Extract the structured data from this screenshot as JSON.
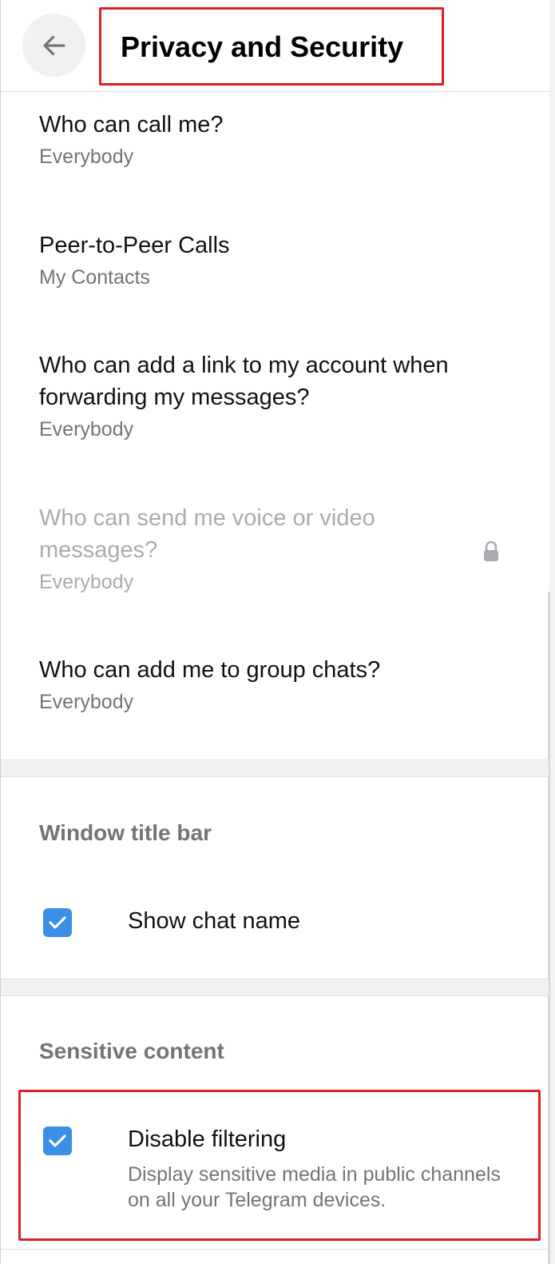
{
  "header": {
    "back_label": "Back",
    "title": "Privacy and Security"
  },
  "privacy_items": [
    {
      "title": "Who can call me?",
      "value": "Everybody"
    },
    {
      "title": "Peer-to-Peer Calls",
      "value": "My Contacts"
    },
    {
      "title": "Who can add a link to my account when forwarding my messages?",
      "value": "Everybody"
    },
    {
      "title": "Who can send me voice or video messages?",
      "value": "Everybody"
    },
    {
      "title": "Who can add me to group chats?",
      "value": "Everybody"
    }
  ],
  "window_title_bar": {
    "heading": "Window title bar",
    "show_chat_name": {
      "label": "Show chat name",
      "checked": true
    }
  },
  "sensitive_content": {
    "heading": "Sensitive content",
    "disable_filtering": {
      "label": "Disable filtering",
      "description": "Display sensitive media in public channels on all your Telegram devices.",
      "checked": true
    }
  },
  "colors": {
    "accent": "#3b8fe6",
    "highlight": "#e02020",
    "secondary_text": "#707579"
  },
  "icons": {
    "back": "arrow-left-icon",
    "lock": "lock-icon",
    "check": "checkmark-icon"
  }
}
